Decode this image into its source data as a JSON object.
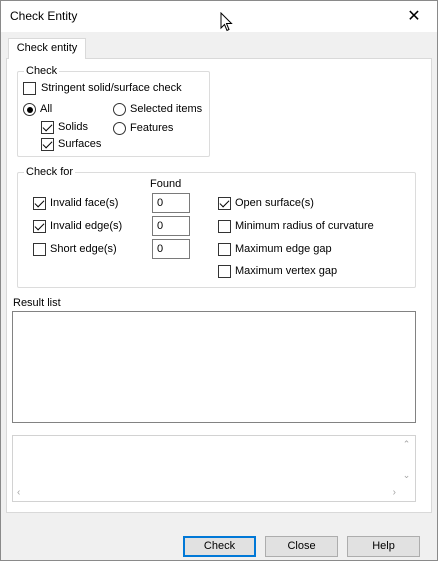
{
  "window": {
    "title": "Check Entity"
  },
  "tabs": [
    {
      "label": "Check entity"
    }
  ],
  "check_group": {
    "legend": "Check",
    "stringent": {
      "label": "Stringent solid/surface check",
      "checked": false
    },
    "all": {
      "label": "All",
      "selected": true
    },
    "solids": {
      "label": "Solids",
      "checked": true
    },
    "surfaces": {
      "label": "Surfaces",
      "checked": true
    },
    "selected_items": {
      "label": "Selected items",
      "selected": false
    },
    "features": {
      "label": "Features",
      "selected": false
    }
  },
  "check_for_group": {
    "legend": "Check for",
    "found_header": "Found",
    "invalid_faces": {
      "label": "Invalid face(s)",
      "checked": true,
      "found": "0"
    },
    "invalid_edges": {
      "label": "Invalid edge(s)",
      "checked": true,
      "found": "0"
    },
    "short_edges": {
      "label": "Short edge(s)",
      "checked": false,
      "found": "0"
    },
    "open_surfaces": {
      "label": "Open surface(s)",
      "checked": true
    },
    "min_radius": {
      "label": "Minimum radius of curvature",
      "checked": false
    },
    "max_edge_gap": {
      "label": "Maximum edge gap",
      "checked": false
    },
    "max_vertex_gap": {
      "label": "Maximum vertex gap",
      "checked": false
    }
  },
  "result_list": {
    "label": "Result list"
  },
  "buttons": {
    "check": "Check",
    "close": "Close",
    "help": "Help"
  },
  "close_glyph": "✕",
  "scroll_glyphs": {
    "up": "⌃",
    "down": "⌄",
    "left": "‹",
    "right": "›"
  },
  "colors": {
    "focus": "#0078d7",
    "button": "#e1e1e1"
  }
}
